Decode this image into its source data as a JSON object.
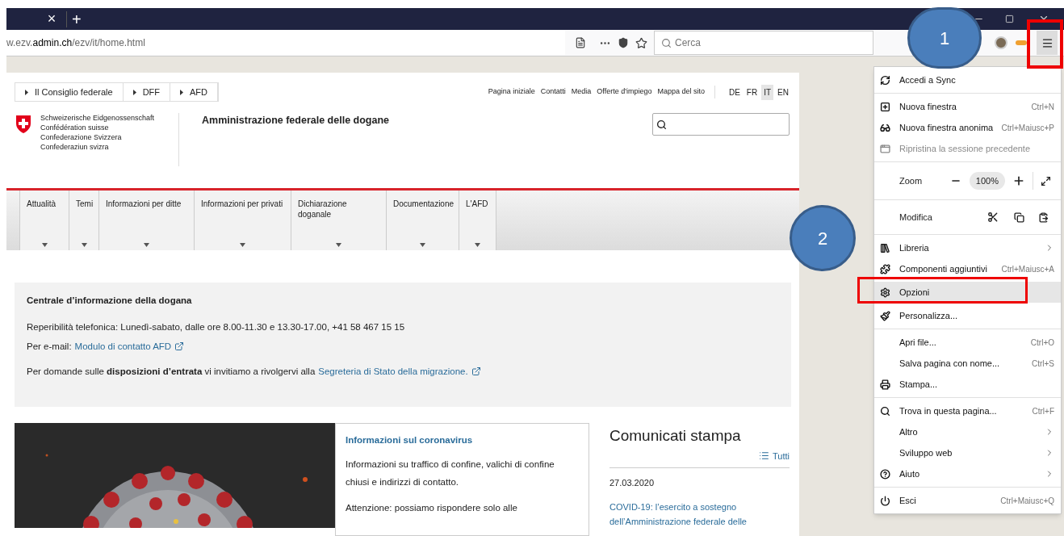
{
  "browser": {
    "tab_close": "×",
    "new_tab": "+",
    "url": {
      "prefix": "w.ezv.",
      "domain": "admin.ch",
      "path": "/ezv/it/home.html"
    },
    "search": {
      "placeholder": "Cerca"
    }
  },
  "callouts": [
    {
      "label": "1"
    },
    {
      "label": "2"
    }
  ],
  "page": {
    "breadcrumbs": [
      "Il Consiglio federale",
      "DFF",
      "AFD"
    ],
    "top_links": [
      "Pagina iniziale",
      "Contatti",
      "Media",
      "Offerte d'impiego",
      "Mappa del sito"
    ],
    "languages": [
      {
        "label": "DE",
        "selected": false
      },
      {
        "label": "FR",
        "selected": false
      },
      {
        "label": "IT",
        "selected": true
      },
      {
        "label": "EN",
        "selected": false
      }
    ],
    "logo_lines": [
      "Schweizerische Eidgenossenschaft",
      "Confédération suisse",
      "Confederazione Svizzera",
      "Confederaziun svizra"
    ],
    "title": "Amministrazione federale delle dogane",
    "nav": [
      {
        "label": "Attualità"
      },
      {
        "label": "Temi"
      },
      {
        "label": "Informazioni per ditte"
      },
      {
        "label": "Informazioni per privati"
      },
      {
        "label": "Dichiarazione doganale"
      },
      {
        "label": "Documentazione"
      },
      {
        "label": "L'AFD"
      }
    ],
    "info": {
      "title": "Centrale d’informazione della dogana",
      "phone": "Reperibilità telefonica: Lunedì-sabato, dalle ore 8.00-11.30 e 13.30-17.00, +41 58 467 15 15",
      "email_label": "Per e-mail:",
      "email_link": "Modulo di contatto AFD",
      "entry_text": "Per domande sulle **disposizioni d’entrata** vi invitiamo a rivolgervi alla",
      "entry_link": "Segreteria di Stato della migrazione."
    },
    "feature": {
      "image": {
        "kind": "picture"
      },
      "title": "Informazioni sul coronavirus",
      "paragraphs": [
        "Informazioni su traffico di confine, valichi di confine chiusi e indirizzi di contatto.",
        "Attenzione: possiamo rispondere solo alle"
      ]
    },
    "press": {
      "title": "Comunicati stampa",
      "all_link": "Tutti",
      "date": "27.03.2020",
      "link": "COVID-19: l’esercito a sostegno dell’Amministrazione federale delle"
    }
  },
  "menu": {
    "sections": [
      {
        "items": [
          {
            "kind": "item",
            "label": "Accedi a Sync",
            "disabled": false,
            "highlighted": false,
            "submenu": false
          }
        ]
      },
      {
        "items": [
          {
            "kind": "item",
            "label": "Nuova finestra",
            "shortcut": "Ctrl+N",
            "disabled": false,
            "highlighted": false,
            "submenu": false
          },
          {
            "kind": "item",
            "label": "Nuova finestra anonima",
            "shortcut": "Ctrl+Maiusc+P",
            "disabled": false,
            "highlighted": false,
            "submenu": false
          },
          {
            "kind": "item",
            "label": "Ripristina la sessione precedente",
            "disabled": true,
            "highlighted": false,
            "submenu": false
          }
        ]
      },
      {
        "items": [
          {
            "kind": "zoom",
            "label": "Zoom",
            "value": "100%"
          }
        ]
      },
      {
        "items": [
          {
            "kind": "edit",
            "label": "Modifica"
          }
        ]
      },
      {
        "items": [
          {
            "kind": "item",
            "label": "Libreria",
            "disabled": false,
            "highlighted": false,
            "submenu": true
          },
          {
            "kind": "item",
            "label": "Componenti aggiuntivi",
            "shortcut": "Ctrl+Maiusc+A",
            "disabled": false,
            "highlighted": false,
            "submenu": false
          },
          {
            "kind": "item",
            "label": "Opzioni",
            "disabled": false,
            "highlighted": true,
            "submenu": false
          },
          {
            "kind": "item",
            "label": "Personalizza...",
            "disabled": false,
            "highlighted": false,
            "submenu": false
          }
        ]
      },
      {
        "items": [
          {
            "kind": "item",
            "label": "Apri file...",
            "shortcut": "Ctrl+O",
            "disabled": false,
            "highlighted": false,
            "submenu": false
          },
          {
            "kind": "item",
            "label": "Salva pagina con nome...",
            "shortcut": "Ctrl+S",
            "disabled": false,
            "highlighted": false,
            "submenu": false
          },
          {
            "kind": "item",
            "label": "Stampa...",
            "disabled": false,
            "highlighted": false,
            "submenu": false
          }
        ]
      },
      {
        "items": [
          {
            "kind": "item",
            "label": "Trova in questa pagina...",
            "shortcut": "Ctrl+F",
            "disabled": false,
            "highlighted": false,
            "submenu": false
          },
          {
            "kind": "item",
            "label": "Altro",
            "disabled": false,
            "highlighted": false,
            "submenu": true
          },
          {
            "kind": "item",
            "label": "Sviluppo web",
            "disabled": false,
            "highlighted": false,
            "submenu": true
          },
          {
            "kind": "item",
            "label": "Aiuto",
            "disabled": false,
            "highlighted": false,
            "submenu": true
          }
        ]
      },
      {
        "items": [
          {
            "kind": "item",
            "label": "Esci",
            "shortcut": "Ctrl+Maiusc+Q",
            "disabled": false,
            "highlighted": false,
            "submenu": false
          }
        ]
      }
    ]
  }
}
